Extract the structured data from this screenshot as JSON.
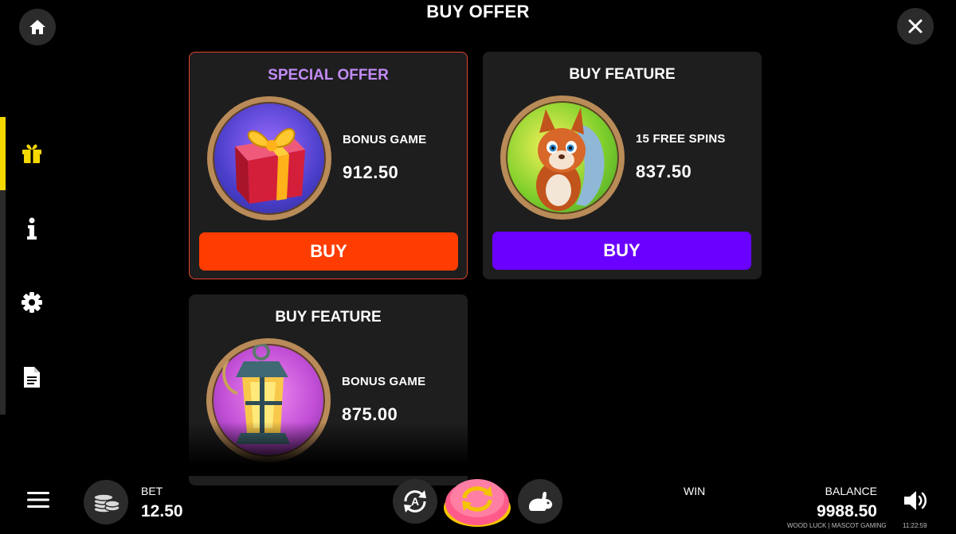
{
  "header": {
    "title": "BUY OFFER"
  },
  "cards": [
    {
      "title": "SPECIAL OFFER",
      "feature": "BONUS GAME",
      "price": "912.50",
      "buy_label": "BUY",
      "button_color": "#ff3d00",
      "art": "gift-box"
    },
    {
      "title": "BUY FEATURE",
      "feature": "15 FREE SPINS",
      "price": "837.50",
      "buy_label": "BUY",
      "button_color": "#6a00ff",
      "art": "squirrel"
    },
    {
      "title": "BUY FEATURE",
      "feature": "BONUS GAME",
      "price": "875.00",
      "art": "lantern"
    }
  ],
  "sidebar": {
    "items": [
      {
        "icon": "gift-icon",
        "active": true
      },
      {
        "icon": "info-icon",
        "active": false
      },
      {
        "icon": "gear-icon",
        "active": false
      },
      {
        "icon": "document-icon",
        "active": false
      }
    ],
    "accent": "#f5d800"
  },
  "footer": {
    "bet_label": "BET",
    "bet_value": "12.50",
    "win_label": "WIN",
    "balance_label": "BALANCE",
    "balance_value": "9988.50",
    "game_credit": "WOOD LUCK | MASCOT GAMING",
    "clock": "11:22:59"
  }
}
